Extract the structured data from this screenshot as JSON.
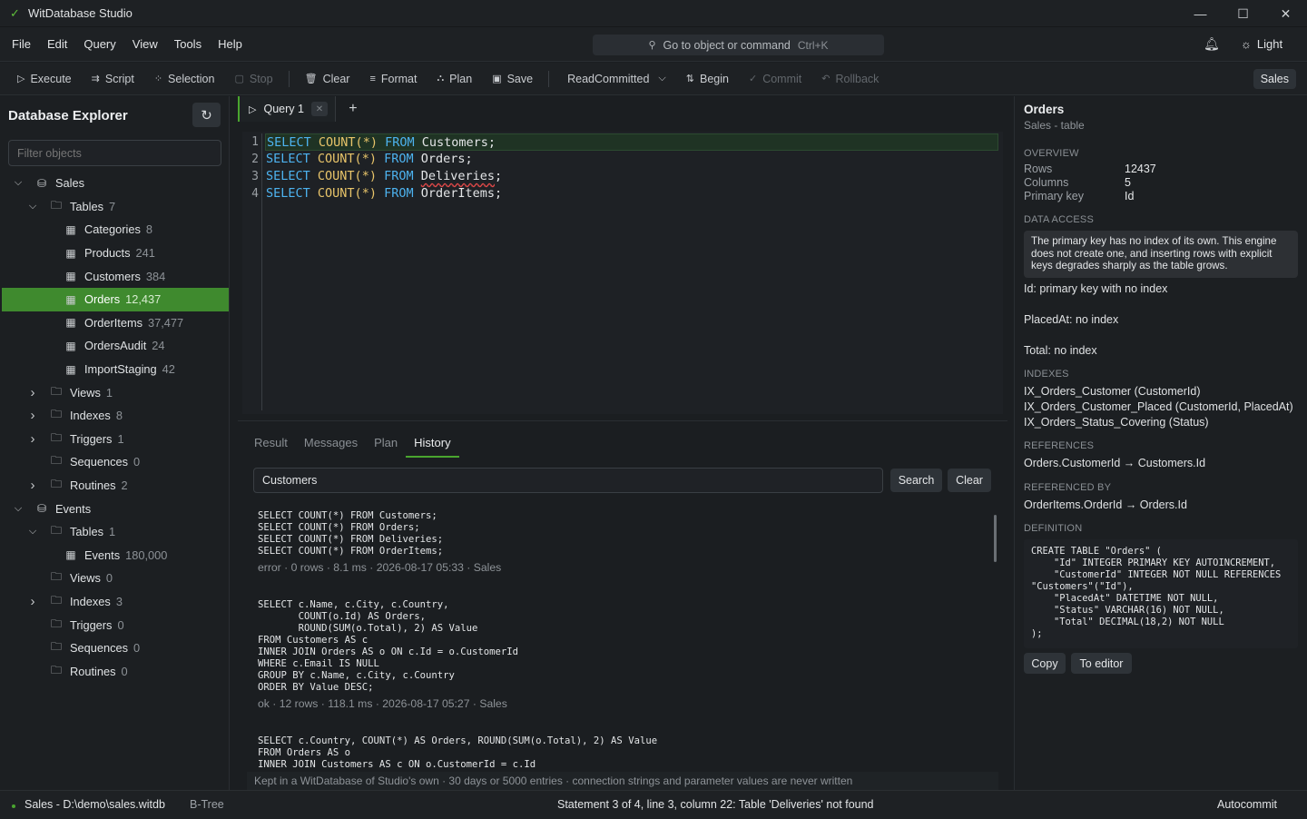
{
  "app": {
    "title": "WitDatabase Studio"
  },
  "menu": [
    "File",
    "Edit",
    "Query",
    "View",
    "Tools",
    "Help"
  ],
  "command": {
    "placeholder": "Go to object or command",
    "shortcut": "Ctrl+K"
  },
  "theme_toggle": "Light",
  "toolbar": {
    "execute": "Execute",
    "script": "Script",
    "selection": "Selection",
    "stop": "Stop",
    "clear": "Clear",
    "format": "Format",
    "plan": "Plan",
    "save": "Save",
    "isolation": "ReadCommitted",
    "begin": "Begin",
    "commit": "Commit",
    "rollback": "Rollback",
    "db_badge": "Sales"
  },
  "explorer": {
    "title": "Database Explorer",
    "filter_placeholder": "Filter objects",
    "nodes": [
      {
        "level": 0,
        "chev": "down",
        "icon": "db",
        "label": "Sales",
        "count": ""
      },
      {
        "level": 1,
        "chev": "down",
        "icon": "folder",
        "label": "Tables",
        "count": "7"
      },
      {
        "level": 2,
        "chev": "",
        "icon": "table",
        "label": "Categories",
        "count": "8"
      },
      {
        "level": 2,
        "chev": "",
        "icon": "table",
        "label": "Products",
        "count": "241"
      },
      {
        "level": 2,
        "chev": "",
        "icon": "table",
        "label": "Customers",
        "count": "384"
      },
      {
        "level": 2,
        "chev": "",
        "icon": "table",
        "label": "Orders",
        "count": "12,437",
        "selected": true
      },
      {
        "level": 2,
        "chev": "",
        "icon": "table",
        "label": "OrderItems",
        "count": "37,477"
      },
      {
        "level": 2,
        "chev": "",
        "icon": "table",
        "label": "OrdersAudit",
        "count": "24"
      },
      {
        "level": 2,
        "chev": "",
        "icon": "table",
        "label": "ImportStaging",
        "count": "42"
      },
      {
        "level": 1,
        "chev": "right",
        "icon": "folder",
        "label": "Views",
        "count": "1"
      },
      {
        "level": 1,
        "chev": "right",
        "icon": "folder",
        "label": "Indexes",
        "count": "8"
      },
      {
        "level": 1,
        "chev": "right",
        "icon": "folder",
        "label": "Triggers",
        "count": "1"
      },
      {
        "level": 1,
        "chev": "",
        "icon": "folder",
        "label": "Sequences",
        "count": "0"
      },
      {
        "level": 1,
        "chev": "right",
        "icon": "folder",
        "label": "Routines",
        "count": "2"
      },
      {
        "level": 0,
        "chev": "down",
        "icon": "db",
        "label": "Events",
        "count": ""
      },
      {
        "level": 1,
        "chev": "down",
        "icon": "folder",
        "label": "Tables",
        "count": "1"
      },
      {
        "level": 2,
        "chev": "",
        "icon": "table",
        "label": "Events",
        "count": "180,000"
      },
      {
        "level": 1,
        "chev": "",
        "icon": "folder",
        "label": "Views",
        "count": "0"
      },
      {
        "level": 1,
        "chev": "right",
        "icon": "folder",
        "label": "Indexes",
        "count": "3"
      },
      {
        "level": 1,
        "chev": "",
        "icon": "folder",
        "label": "Triggers",
        "count": "0"
      },
      {
        "level": 1,
        "chev": "",
        "icon": "folder",
        "label": "Sequences",
        "count": "0"
      },
      {
        "level": 1,
        "chev": "",
        "icon": "folder",
        "label": "Routines",
        "count": "0"
      }
    ]
  },
  "editor": {
    "tab": "Query 1",
    "lines": [
      {
        "n": "1",
        "table": "Customers",
        "error": false
      },
      {
        "n": "2",
        "table": "Orders",
        "error": false
      },
      {
        "n": "3",
        "table": "Deliveries",
        "error": true
      },
      {
        "n": "4",
        "table": "OrderItems",
        "error": false
      }
    ],
    "kw_select": "SELECT",
    "fn_count": "COUNT(*)",
    "kw_from": "FROM"
  },
  "results": {
    "tabs": [
      "Result",
      "Messages",
      "Plan",
      "History"
    ],
    "active_tab": "History",
    "search_value": "Customers",
    "search_button": "Search",
    "clear_button": "Clear",
    "history": [
      {
        "sql": "SELECT COUNT(*) FROM Customers;\nSELECT COUNT(*) FROM Orders;\nSELECT COUNT(*) FROM Deliveries;\nSELECT COUNT(*) FROM OrderItems;",
        "meta": "error · 0 rows · 8.1 ms · 2026-08-17 05:33 · Sales"
      },
      {
        "sql": "SELECT c.Name, c.City, c.Country,\n       COUNT(o.Id) AS Orders,\n       ROUND(SUM(o.Total), 2) AS Value\nFROM Customers AS c\nINNER JOIN Orders AS o ON c.Id = o.CustomerId\nWHERE c.Email IS NULL\nGROUP BY c.Name, c.City, c.Country\nORDER BY Value DESC;",
        "meta": "ok · 12 rows · 118.1 ms · 2026-08-17 05:27 · Sales"
      },
      {
        "sql": "SELECT c.Country, COUNT(*) AS Orders, ROUND(SUM(o.Total), 2) AS Value\nFROM Orders AS o\nINNER JOIN Customers AS c ON o.CustomerId = c.Id\nGROUP BY c.Country",
        "meta": ""
      }
    ],
    "note": "Kept in a WitDatabase of Studio's own · 30 days or 5000 entries · connection strings and parameter values are never written"
  },
  "details": {
    "title": "Orders",
    "subtitle": "Sales - table",
    "overview_label": "OVERVIEW",
    "rows_label": "Rows",
    "rows_value": "12437",
    "columns_label": "Columns",
    "columns_value": "5",
    "pk_label": "Primary key",
    "pk_value": "Id",
    "data_access_label": "DATA ACCESS",
    "warning": "The primary key has no index of its own. This engine does not create one, and inserting rows with explicit keys degrades sharply as the table grows.",
    "access": [
      "Id: primary key with no index",
      "PlacedAt: no index",
      "Total: no index"
    ],
    "indexes_label": "INDEXES",
    "indexes": [
      "IX_Orders_Customer (CustomerId)",
      "IX_Orders_Customer_Placed (CustomerId, PlacedAt)",
      "IX_Orders_Status_Covering (Status)"
    ],
    "references_label": "REFERENCES",
    "references": "Orders.CustomerId → Customers.Id",
    "referenced_label": "REFERENCED BY",
    "referenced": "OrderItems.OrderId → Orders.Id",
    "definition_label": "DEFINITION",
    "definition": "CREATE TABLE \"Orders\" (\n    \"Id\" INTEGER PRIMARY KEY AUTOINCREMENT,\n    \"CustomerId\" INTEGER NOT NULL REFERENCES\n\"Customers\"(\"Id\"),\n    \"PlacedAt\" DATETIME NOT NULL,\n    \"Status\" VARCHAR(16) NOT NULL,\n    \"Total\" DECIMAL(18,2) NOT NULL\n);",
    "copy_button": "Copy",
    "to_editor_button": "To editor"
  },
  "status": {
    "connection": "Sales - D:\\demo\\sales.witdb",
    "engine": "B-Tree",
    "message": "Statement 3 of 4, line 3, column 22: Table 'Deliveries' not found",
    "mode": "Autocommit"
  },
  "colors": {
    "accent": "#4aa52f",
    "keyword": "#4db3f0",
    "function": "#e9c56a",
    "error": "#e04848"
  }
}
